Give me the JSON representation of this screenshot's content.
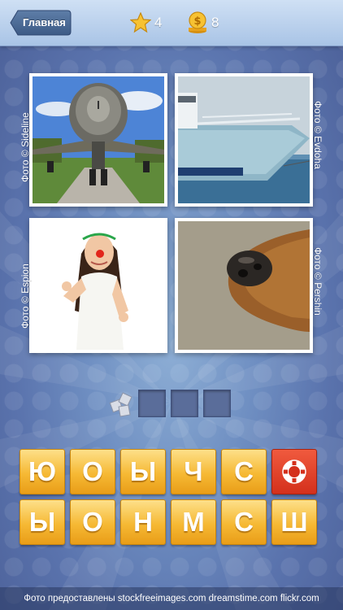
{
  "header": {
    "back_label": "Главная",
    "stars": "4",
    "coins": "8"
  },
  "photos": [
    {
      "subject": "fighter-jet",
      "credit": "Фото © Sideline",
      "side": "left"
    },
    {
      "subject": "yacht",
      "credit": "Фото © Evdoha",
      "side": "right"
    },
    {
      "subject": "woman-clown-nose",
      "credit": "Фото © Espion",
      "side": "left"
    },
    {
      "subject": "dog-nose",
      "credit": "Фото © Pershin",
      "side": "right"
    }
  ],
  "answer": {
    "slots": 3,
    "filled": [
      "",
      "",
      ""
    ]
  },
  "tiles": {
    "row1": [
      "Ю",
      "О",
      "Ы",
      "Ч",
      "С"
    ],
    "row2": [
      "Ы",
      "О",
      "Н",
      "М",
      "С",
      "Ш"
    ],
    "help_icon": "lifebuoy-icon"
  },
  "footer": {
    "text": "Фото предоставлены stockfreeimages.com dreamstime.com flickr.com"
  },
  "colors": {
    "tile": "#f6b934",
    "help_tile": "#d4301c",
    "slot": "#5a6d9a"
  }
}
